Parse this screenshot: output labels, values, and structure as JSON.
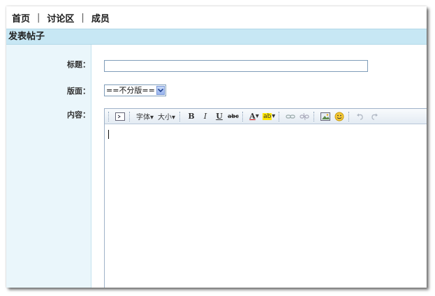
{
  "nav": {
    "items": [
      {
        "label": "首页"
      },
      {
        "label": "讨论区"
      },
      {
        "label": "成员"
      }
    ],
    "separator": "|"
  },
  "page_title": "发表帖子",
  "form": {
    "title_label": "标题：",
    "title_value": "",
    "forum_label": "版面：",
    "forum_selected": "==不分版==",
    "content_label": "内容："
  },
  "editor_toolbar": {
    "font_label": "字体",
    "size_label": "大小",
    "bold": "B",
    "italic": "I",
    "underline": "U",
    "strike": "abc",
    "font_color": "A",
    "highlight": "ab"
  },
  "colors": {
    "titlebar_bg": "#c7e7f4",
    "leftcol_bg": "#eaf6fb",
    "input_border": "#7f9db9"
  }
}
